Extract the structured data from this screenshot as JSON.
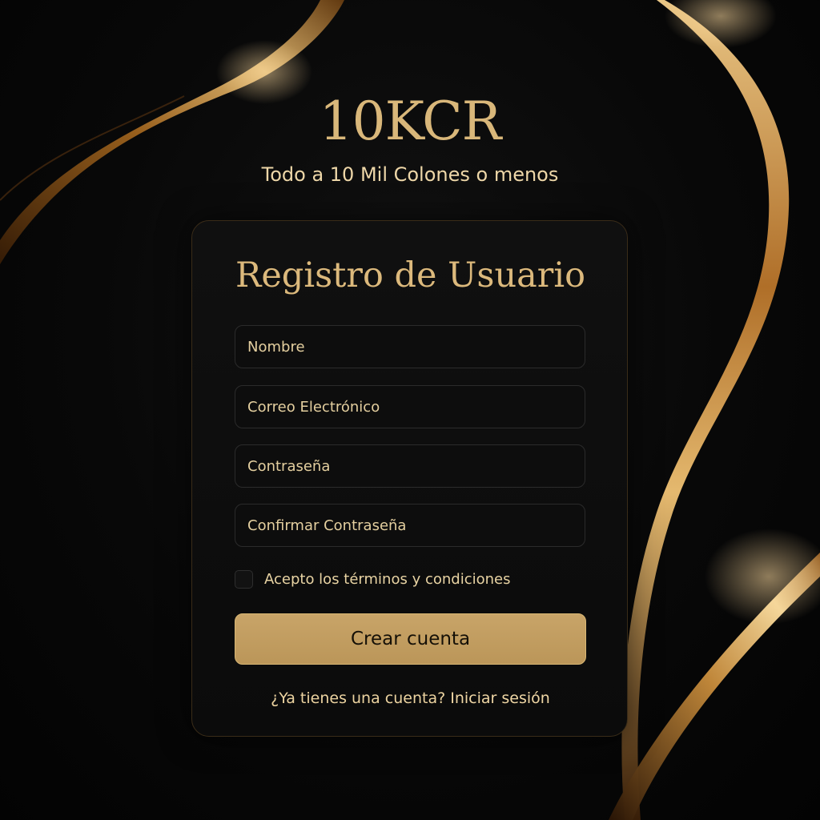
{
  "brand": {
    "name": "10KCR",
    "tagline": "Todo a 10 Mil Colones o menos"
  },
  "form": {
    "title": "Registro de Usuario",
    "name_placeholder": "Nombre",
    "email_placeholder": "Correo Electrónico",
    "password_placeholder": "Contraseña",
    "confirm_password_placeholder": "Confirmar Contraseña",
    "terms_label": "Acepto los términos y condiciones",
    "terms_checked": false,
    "submit_label": "Crear cuenta",
    "login_prompt": "¿Ya tienes una cuenta?",
    "login_link": "Iniciar sesión"
  },
  "colors": {
    "background": "#050505",
    "gold_accent": "#c8a468",
    "text_gold": "#e4cf9f"
  }
}
